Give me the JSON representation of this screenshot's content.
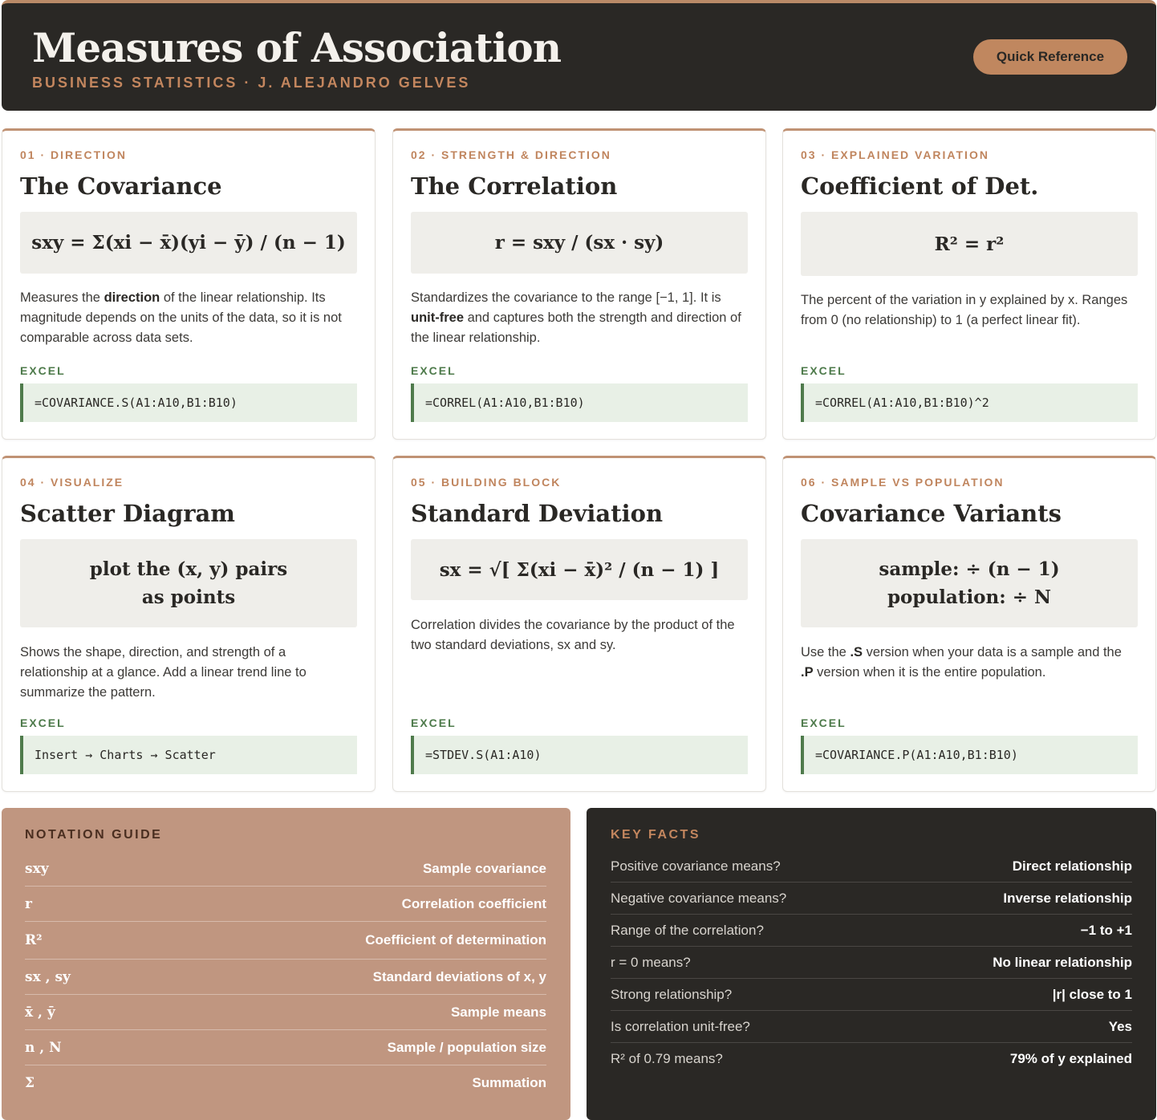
{
  "header": {
    "title": "Measures of Association",
    "subtitle": "BUSINESS STATISTICS · J. ALEJANDRO GELVES",
    "button_label": "Quick Reference"
  },
  "cards": [
    {
      "kicker": "01 · DIRECTION",
      "title": "The Covariance",
      "formula_lines": [
        "sxy = Σ(xi − x̄)(yi − ȳ) / (n − 1)"
      ],
      "desc_parts": [
        "Measures the ",
        "direction",
        " of the linear relationship. Its magnitude depends on the units of the data, so it is not comparable across data sets."
      ],
      "excel_label": "EXCEL",
      "excel": "=COVARIANCE.S(A1:A10,B1:B10)"
    },
    {
      "kicker": "02 · STRENGTH & DIRECTION",
      "title": "The Correlation",
      "formula_lines": [
        "r = sxy / (sx · sy)"
      ],
      "desc_parts": [
        "Standardizes the covariance to the range [−1, 1]. It is ",
        "unit-free",
        " and captures both the strength and direction of the linear relationship."
      ],
      "excel_label": "EXCEL",
      "excel": "=CORREL(A1:A10,B1:B10)"
    },
    {
      "kicker": "03 · EXPLAINED VARIATION",
      "title": "Coefficient of Det.",
      "formula_lines": [
        "R² = r²"
      ],
      "desc_parts": [
        "The percent of the variation in y explained by x. Ranges from 0 (no relationship) to 1 (a perfect linear fit)."
      ],
      "excel_label": "EXCEL",
      "excel": "=CORREL(A1:A10,B1:B10)^2"
    },
    {
      "kicker": "04 · VISUALIZE",
      "title": "Scatter Diagram",
      "formula_lines": [
        "plot the (x, y) pairs",
        "as points"
      ],
      "desc_parts": [
        "Shows the shape, direction, and strength of a relationship at a glance. Add a linear trend line to summarize the pattern."
      ],
      "excel_label": "EXCEL",
      "excel": "Insert → Charts → Scatter"
    },
    {
      "kicker": "05 · BUILDING BLOCK",
      "title": "Standard Deviation",
      "formula_lines": [
        "sx = √[ Σ(xi − x̄)² / (n − 1) ]"
      ],
      "desc_parts": [
        "Correlation divides the covariance by the product of the two standard deviations, sx and sy."
      ],
      "excel_label": "EXCEL",
      "excel": "=STDEV.S(A1:A10)"
    },
    {
      "kicker": "06 · SAMPLE VS POPULATION",
      "title": "Covariance Variants",
      "formula_lines": [
        "sample: ÷ (n − 1)",
        "population: ÷ N"
      ],
      "desc_parts": [
        "Use the ",
        ".S",
        " version when your data is a sample and the ",
        ".P",
        " version when it is the entire population."
      ],
      "excel_label": "EXCEL",
      "excel": "=COVARIANCE.P(A1:A10,B1:B10)"
    }
  ],
  "notation": {
    "title": "NOTATION GUIDE",
    "rows": [
      {
        "sym": "sxy",
        "meaning": "Sample covariance"
      },
      {
        "sym": "r",
        "meaning": "Correlation coefficient"
      },
      {
        "sym": "R²",
        "meaning": "Coefficient of determination"
      },
      {
        "sym": "sx , sy",
        "meaning": "Standard deviations of x, y"
      },
      {
        "sym": "x̄ , ȳ",
        "meaning": "Sample means"
      },
      {
        "sym": "n , N",
        "meaning": "Sample / population size"
      },
      {
        "sym": "Σ",
        "meaning": "Summation"
      }
    ]
  },
  "facts": {
    "title": "KEY FACTS",
    "rows": [
      {
        "q": "Positive covariance means?",
        "a": "Direct relationship"
      },
      {
        "q": "Negative covariance means?",
        "a": "Inverse relationship"
      },
      {
        "q": "Range of the correlation?",
        "a": "−1 to +1"
      },
      {
        "q": "r = 0 means?",
        "a": "No linear relationship"
      },
      {
        "q": "Strong relationship?",
        "a": "|r| close to 1"
      },
      {
        "q": "Is correlation unit-free?",
        "a": "Yes"
      },
      {
        "q": "R² of 0.79 means?",
        "a": "79% of y explained"
      }
    ]
  }
}
